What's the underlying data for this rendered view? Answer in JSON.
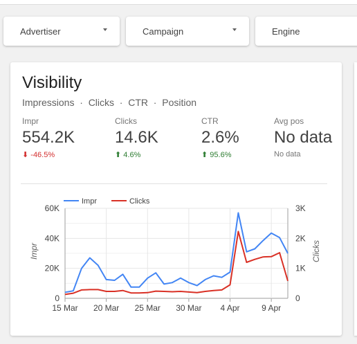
{
  "filters": {
    "advertiser": "Advertiser",
    "campaign": "Campaign",
    "engine": "Engine"
  },
  "card": {
    "title": "Visibility",
    "subtitle": "Impressions  ·  Clicks  ·  CTR  ·  Position"
  },
  "metrics": [
    {
      "label": "Impr",
      "value": "554.2K",
      "change": "-46.5%",
      "direction": "down"
    },
    {
      "label": "Clicks",
      "value": "14.6K",
      "change": "4.6%",
      "direction": "up"
    },
    {
      "label": "CTR",
      "value": "2.6%",
      "change": "95.6%",
      "direction": "up"
    },
    {
      "label": "Avg pos",
      "value": "No data",
      "change": "No data",
      "direction": "none"
    }
  ],
  "colors": {
    "impr": "#4285f4",
    "clicks": "#d93025",
    "down": "#d32f2f",
    "up": "#2e7d32"
  },
  "chart_data": {
    "type": "line",
    "x": [
      "15 Mar",
      "16 Mar",
      "17 Mar",
      "18 Mar",
      "19 Mar",
      "20 Mar",
      "21 Mar",
      "22 Mar",
      "23 Mar",
      "24 Mar",
      "25 Mar",
      "26 Mar",
      "27 Mar",
      "28 Mar",
      "29 Mar",
      "30 Mar",
      "31 Mar",
      "1 Apr",
      "2 Apr",
      "3 Apr",
      "4 Apr",
      "5 Apr",
      "6 Apr",
      "7 Apr",
      "8 Apr",
      "9 Apr",
      "10 Apr",
      "11 Apr"
    ],
    "x_ticks": [
      "15 Mar",
      "20 Mar",
      "25 Mar",
      "30 Mar",
      "4 Apr",
      "9 Apr"
    ],
    "series": [
      {
        "name": "Impr",
        "axis": "left",
        "values": [
          4000,
          5000,
          20000,
          27000,
          22000,
          12500,
          12000,
          16000,
          7500,
          7500,
          13500,
          17000,
          9500,
          10500,
          13500,
          10500,
          8500,
          12500,
          15000,
          14000,
          17500,
          57000,
          31000,
          33000,
          38500,
          43500,
          40500,
          30000
        ]
      },
      {
        "name": "Clicks",
        "axis": "right",
        "values": [
          130,
          170,
          280,
          290,
          290,
          230,
          230,
          260,
          180,
          180,
          190,
          240,
          230,
          220,
          230,
          210,
          190,
          230,
          260,
          280,
          450,
          2230,
          1200,
          1300,
          1380,
          1390,
          1520,
          580
        ]
      }
    ],
    "ylabel": "Impr",
    "y2label": "Clicks",
    "ylim": [
      0,
      60000
    ],
    "y2lim": [
      0,
      3000
    ],
    "y_ticks": [
      "0",
      "20K",
      "40K",
      "60K"
    ],
    "y2_ticks": [
      "0",
      "1K",
      "2K",
      "3K"
    ],
    "legend": "top",
    "grid": true
  }
}
